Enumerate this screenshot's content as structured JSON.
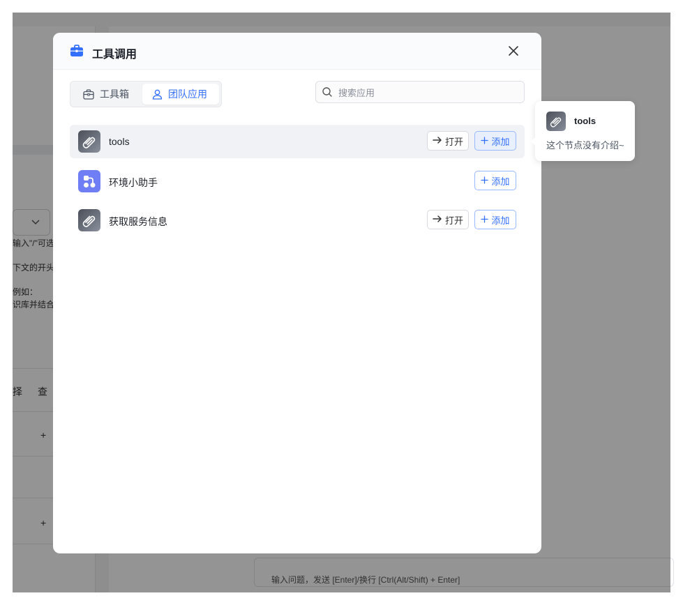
{
  "background": {
    "hint_lines": [
      "输入\"/\"可选",
      "下文的开头，",
      "例如：",
      "识库并结合",
      "择",
      "查"
    ],
    "input_hint": "输入问题，发送 [Enter]/换行 [Ctrl(Alt/Shift) + Enter]",
    "plus": "+"
  },
  "modal": {
    "title": "工具调用",
    "tabs": [
      {
        "label": "工具箱",
        "icon": "toolbox-icon"
      },
      {
        "label": "团队应用",
        "icon": "user-icon"
      }
    ],
    "search": {
      "placeholder": "搜索应用",
      "value": ""
    },
    "apps": [
      {
        "name": "tools",
        "icon": "paperclip-icon",
        "open_label": "打开",
        "add_label": "添加"
      },
      {
        "name": "环境小助手",
        "icon": "workflow-icon",
        "add_label": "添加"
      },
      {
        "name": "获取服务信息",
        "icon": "paperclip-icon",
        "open_label": "打开",
        "add_label": "添加"
      }
    ]
  },
  "tooltip": {
    "name": "tools",
    "description": "这个节点没有介绍~"
  },
  "colors": {
    "primary": "#3370ff",
    "overlay": "#000000"
  }
}
